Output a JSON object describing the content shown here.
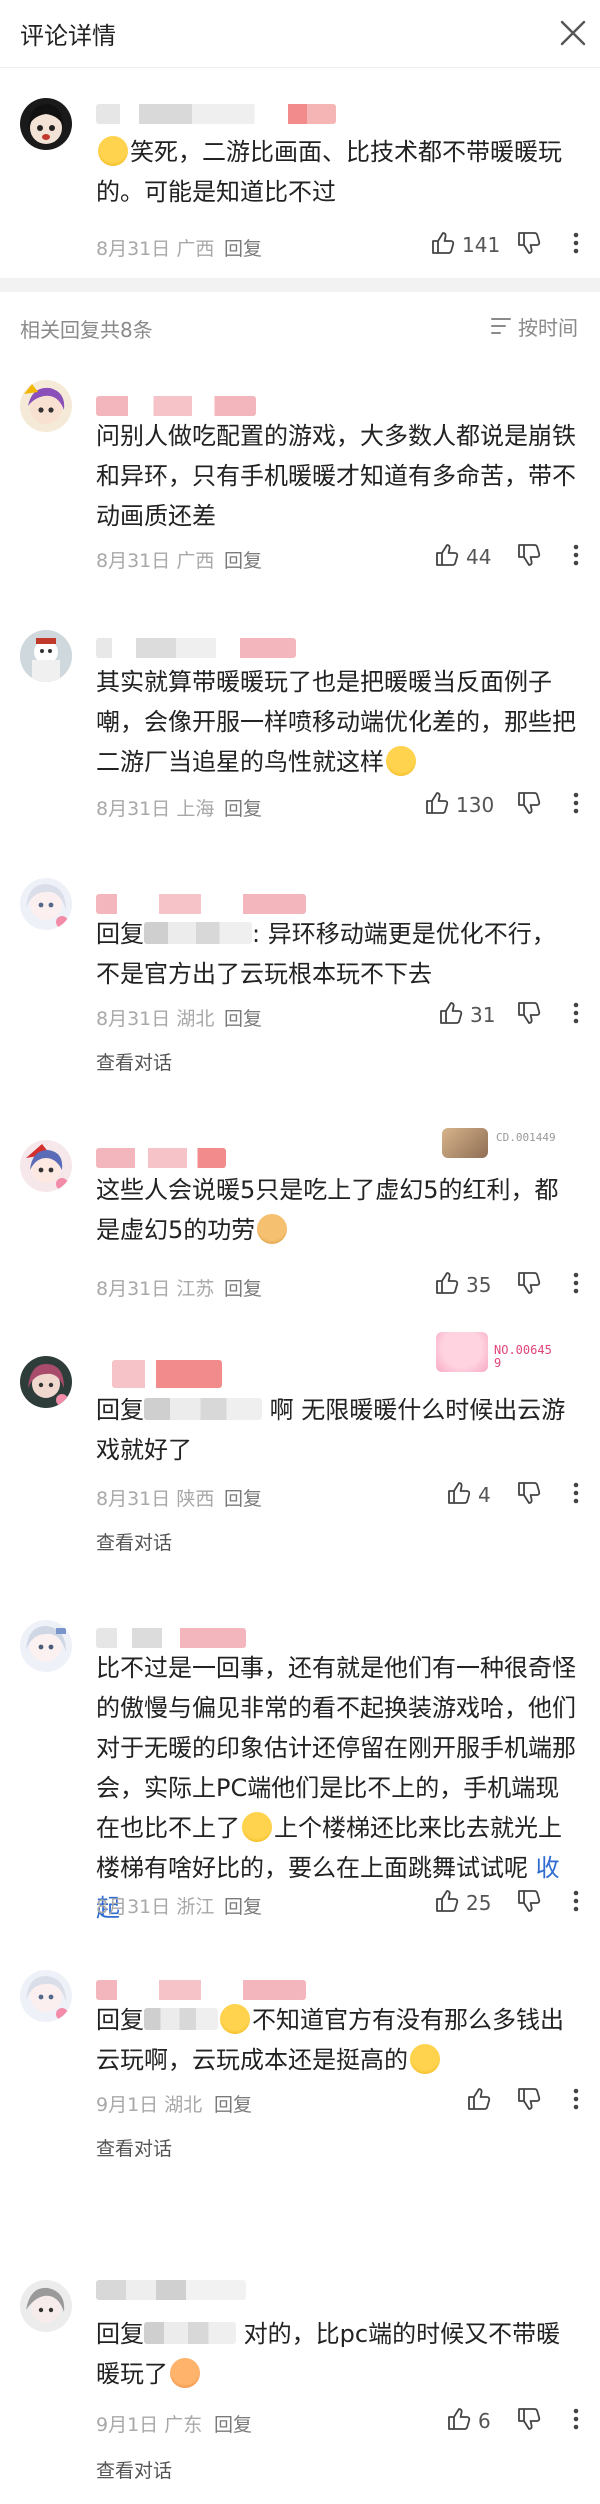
{
  "header": {
    "title": "评论详情"
  },
  "main_comment": {
    "text": "笑死，二游比画面、比技术都不带暖暖玩的。可能是知道比不过",
    "date": "8月31日",
    "location": "广西",
    "reply_label": "回复",
    "likes": "141"
  },
  "replies_header": {
    "title": "相关回复共8条",
    "sort_label": "按时间"
  },
  "replies": [
    {
      "text": "问别人做吃配置的游戏，大多数人都说是崩铁和异环，只有手机暖暖才知道有多命苦，带不动画质还差",
      "date": "8月31日",
      "location": "广西",
      "reply_label": "回复",
      "likes": "44"
    },
    {
      "text": "其实就算带暖暖玩了也是把暖暖当反面例子嘲，会像开服一样喷移动端优化差的，那些把二游厂当追星的鸟性就这样",
      "date": "8月31日",
      "location": "上海",
      "reply_label": "回复",
      "likes": "130"
    },
    {
      "prefix": "回复",
      "text": ": 异环移动端更是优化不行，不是官方出了云玩根本玩不下去",
      "date": "8月31日",
      "location": "湖北",
      "reply_label": "回复",
      "likes": "31",
      "view_conversation": "查看对话"
    },
    {
      "text": "这些人会说暖5只是吃上了虚幻5的红利，都是虚幻5的功劳",
      "date": "8月31日",
      "location": "江苏",
      "reply_label": "回复",
      "likes": "35",
      "badge": "CD.001449"
    },
    {
      "prefix": "回复",
      "text": "啊 无限暖暖什么时候出云游戏就好了",
      "date": "8月31日",
      "location": "陕西",
      "reply_label": "回复",
      "likes": "4",
      "view_conversation": "查看对话",
      "badge": "NO.006459"
    },
    {
      "text": "比不过是一回事，还有就是他们有一种很奇怪的傲慢与偏见非常的看不起换装游戏哈，他们对于无暖的印象估计还停留在刚开服手机端那会，实际上PC端他们是比不上的，手机端现在也比不上了",
      "text2": "上个楼梯还比来比去就光上楼梯有啥好比的，要么在上面跳舞试试呢",
      "collapse": "收起",
      "date": "8月31日",
      "location": "浙江",
      "reply_label": "回复",
      "likes": "25"
    },
    {
      "prefix": "回复",
      "text": "不知道官方有没有那么多钱出云玩啊，云玩成本还是挺高的",
      "date": "9月1日",
      "location": "湖北",
      "reply_label": "回复",
      "likes": "",
      "view_conversation": "查看对话"
    },
    {
      "prefix": "回复",
      "text": "对的，比pc端的时候又不带暖暖玩了",
      "date": "9月1日",
      "location": "广东",
      "reply_label": "回复",
      "likes": "6",
      "view_conversation": "查看对话"
    }
  ],
  "colors": {
    "accent_link": "#2f6bd1",
    "meta_gray": "#a8a8a8",
    "divider": "#f2f2f2",
    "name_blur_pink": "#f4b6bd"
  },
  "icons": [
    "close-icon",
    "sort-icon",
    "like-icon",
    "dislike-icon",
    "more-icon",
    "emoji"
  ]
}
